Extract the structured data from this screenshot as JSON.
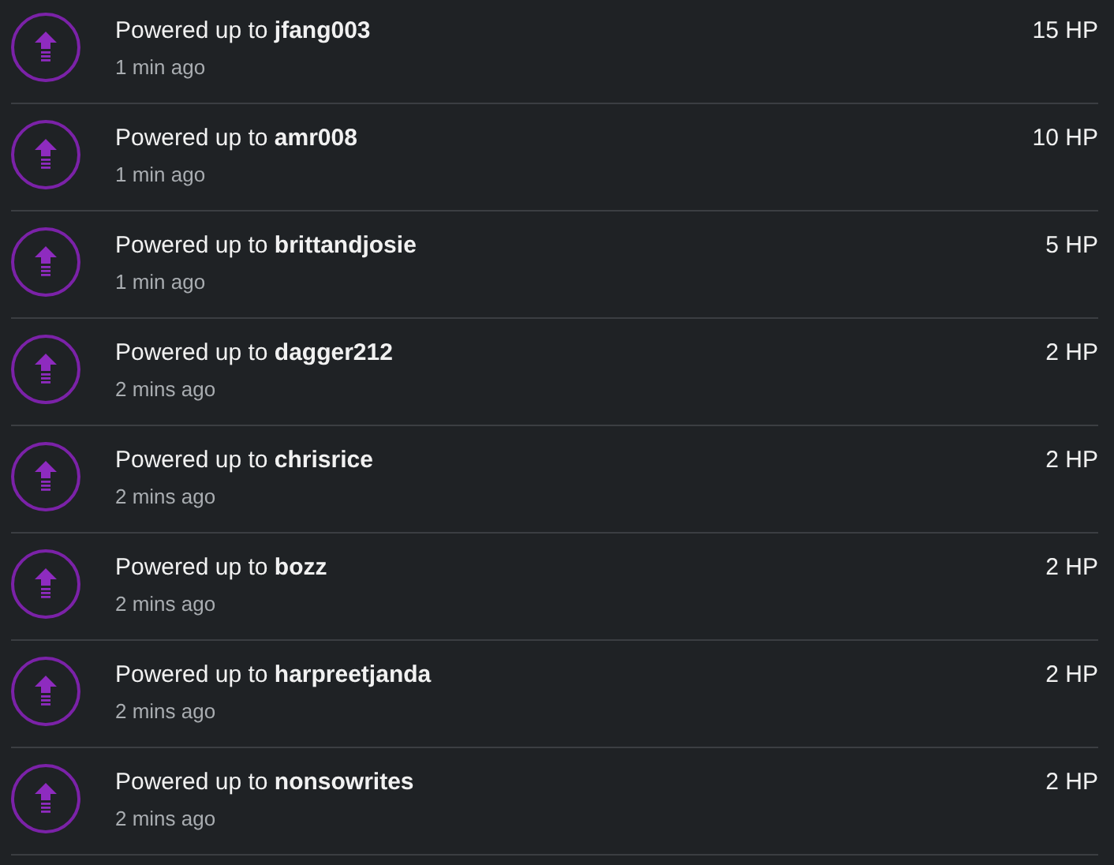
{
  "activities": [
    {
      "text": "Powered up to **jfang003**",
      "time": "1 min ago",
      "amount": "15 HP"
    },
    {
      "text": "Powered up to **amr008**",
      "time": "1 min ago",
      "amount": "10 HP"
    },
    {
      "text": "Powered up to **brittandjosie**",
      "time": "1 min ago",
      "amount": "5 HP"
    },
    {
      "text": "Powered up to **dagger212**",
      "time": "2 mins ago",
      "amount": "2 HP"
    },
    {
      "text": "Powered up to **chrisrice**",
      "time": "2 mins ago",
      "amount": "2 HP"
    },
    {
      "text": "Powered up to **bozz**",
      "time": "2 mins ago",
      "amount": "2 HP"
    },
    {
      "text": "Powered up to **harpreetjanda**",
      "time": "2 mins ago",
      "amount": "2 HP"
    },
    {
      "text": "Powered up to **nonsowrites**",
      "time": "2 mins ago",
      "amount": "2 HP"
    }
  ]
}
